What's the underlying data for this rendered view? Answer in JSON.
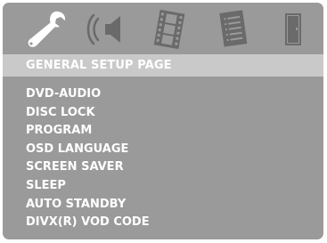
{
  "icons": {
    "general_setup": "wrench-icon",
    "audio_setup": "speaker-icon",
    "video_setup": "film-icon",
    "preference": "document-icon",
    "exit": "door-icon"
  },
  "header": {
    "title": "GENERAL SETUP PAGE"
  },
  "menu": {
    "items": [
      {
        "label": "DVD-AUDIO"
      },
      {
        "label": "DISC LOCK"
      },
      {
        "label": "PROGRAM"
      },
      {
        "label": "OSD LANGUAGE"
      },
      {
        "label": "SCREEN SAVER"
      },
      {
        "label": "SLEEP"
      },
      {
        "label": "AUTO STANDBY"
      },
      {
        "label": "DIVX(R) VOD CODE"
      }
    ]
  },
  "colors": {
    "panel_background": "#9a9a9a",
    "title_bar_background": "#c9c9c9",
    "active_icon": "#ffffff",
    "inactive_icon": "#6a6a6a",
    "text": "#ffffff"
  }
}
